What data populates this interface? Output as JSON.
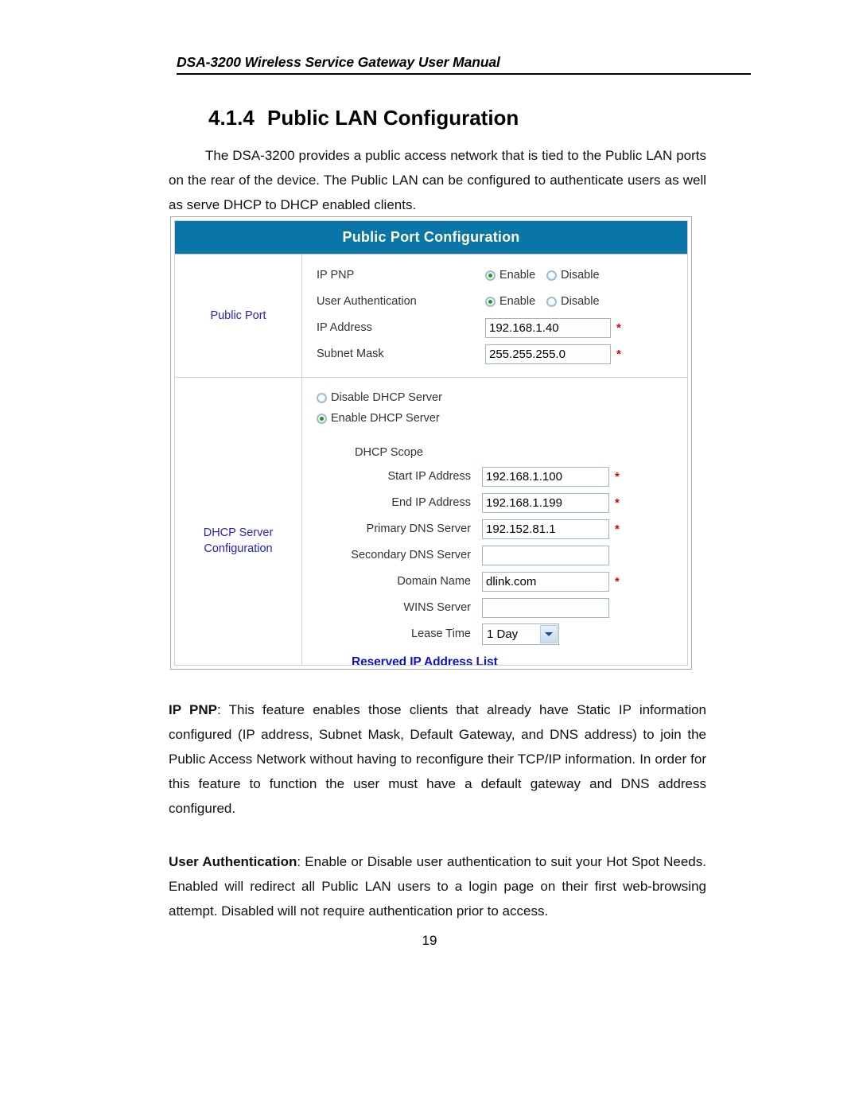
{
  "document": {
    "running_header": "DSA-3200 Wireless Service Gateway User Manual",
    "section_number": "4.1.4",
    "section_title": "Public LAN Configuration",
    "intro_paragraph": "The DSA-3200 provides a public access network that is tied to the Public LAN ports on the rear of the device. The Public LAN can be configured to authenticate users as well as serve DHCP to DHCP enabled clients.",
    "ippnp_term": "IP PNP",
    "ippnp_body": ": This feature enables those clients that already have Static IP information configured (IP address, Subnet Mask, Default Gateway, and DNS address) to join the Public Access Network without having to reconfigure their TCP/IP information. In order for this feature to function the user must have a default gateway and DNS address configured.",
    "auth_term": "User Authentication",
    "auth_body": ": Enable or Disable user authentication to suit your Hot Spot Needs. Enabled will redirect all Public LAN users to a login page on their first web-browsing attempt. Disabled will not require authentication prior to access.",
    "page_number": "19"
  },
  "ui": {
    "title": "Public Port Configuration",
    "title_bar_color": "#0a76a8",
    "title_text_color": "#fffbe0",
    "link_color": "#2323c8",
    "required_marker": "*",
    "public_port": {
      "nav_label": "Public Port",
      "rows": {
        "ip_pnp_label": "IP PNP",
        "user_auth_label": "User Authentication",
        "ip_address_label": "IP Address",
        "subnet_mask_label": "Subnet Mask"
      },
      "radio_enable": "Enable",
      "radio_disable": "Disable",
      "ip_pnp_value": "Enable",
      "user_auth_value": "Enable",
      "ip_address_value": "192.168.1.40",
      "subnet_mask_value": "255.255.255.0"
    },
    "dhcp": {
      "nav_label_line1": "DHCP Server",
      "nav_label_line2": "Configuration",
      "disable_label": "Disable DHCP Server",
      "enable_label": "Enable DHCP Server",
      "selected_mode": "Enable DHCP Server",
      "scope_title": "DHCP Scope",
      "start_ip_label": "Start IP Address",
      "start_ip_value": "192.168.1.100",
      "end_ip_label": "End  IP Address",
      "end_ip_value": "192.168.1.199",
      "primary_dns_label": "Primary DNS Server",
      "primary_dns_value": "192.152.81.1",
      "secondary_dns_label": "Secondary DNS Server",
      "secondary_dns_value": "",
      "domain_name_label": "Domain Name",
      "domain_name_value": "dlink.com",
      "wins_label": "WINS Server",
      "wins_value": "",
      "lease_time_label": "Lease Time",
      "lease_time_value": "1 Day",
      "reserved_link": "Reserved IP Address List"
    }
  }
}
